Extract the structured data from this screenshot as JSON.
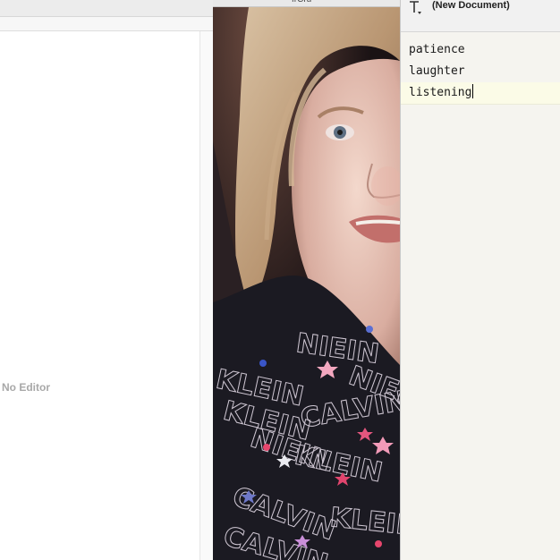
{
  "left_pane": {
    "placeholder_text": "No Editor"
  },
  "photo_panel": {
    "title_partial": "frCru",
    "sweater_text": [
      "NIEIN",
      "KLEIN",
      "NIEIN",
      "KLEIN",
      "CALVIN",
      "NIEIN",
      "KLEIN",
      "CALVIN",
      "CALVIN",
      "KLEIN"
    ]
  },
  "document": {
    "title": "(New Document)",
    "text_tool_icon": "text-cursor-icon",
    "lines": [
      "patience",
      "laughter",
      "listening"
    ],
    "current_line_index": 2
  },
  "colors": {
    "document_background": "#f5f4ef",
    "current_line_highlight": "#fbfbe7",
    "placeholder_text": "#a8a8a8"
  }
}
